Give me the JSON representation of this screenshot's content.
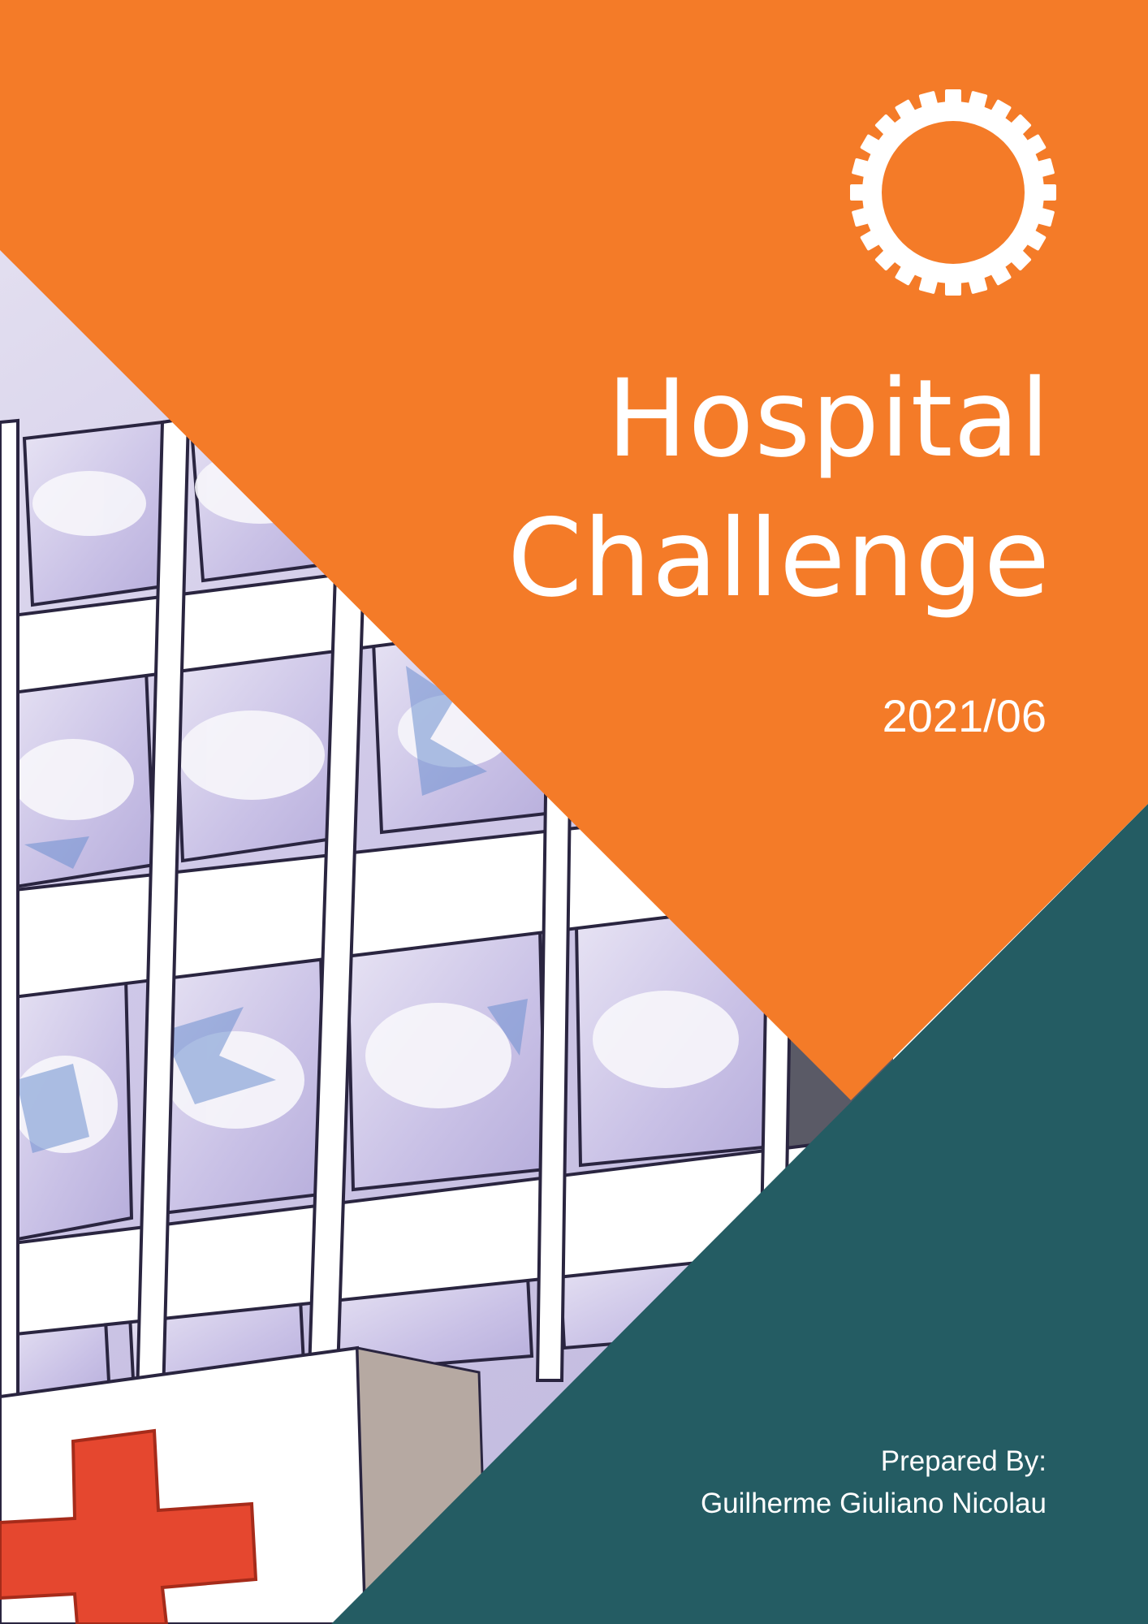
{
  "cover": {
    "title_line_1": "Hospital",
    "title_line_2": "Challenge",
    "date": "2021/06",
    "prepared_label": "Prepared By:",
    "author": "Guilherme Giuliano Nicolau"
  },
  "colors": {
    "orange": "#F47B28",
    "teal": "#245C63",
    "white": "#FFFFFF",
    "cross_red": "#E5472F"
  },
  "icons": {
    "logo": "gear-icon",
    "photo_cross": "red-cross-icon"
  }
}
